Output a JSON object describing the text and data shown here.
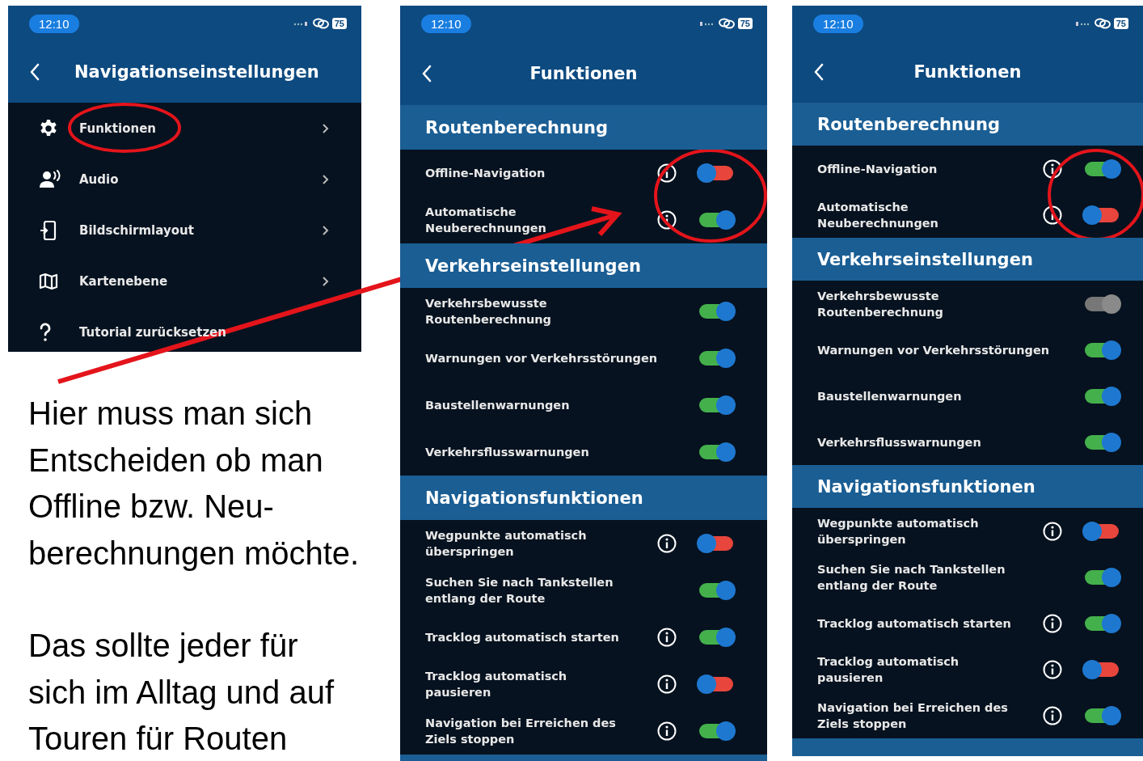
{
  "screens": [
    {
      "status": {
        "time": "12:10",
        "battery": "75"
      },
      "title": "Navigationseinstellungen",
      "menu": [
        {
          "label": "Funktionen",
          "chevron": true
        },
        {
          "label": "Audio",
          "chevron": true
        },
        {
          "label": "Bildschirmlayout",
          "chevron": true
        },
        {
          "label": "Kartenebene",
          "chevron": true
        },
        {
          "label": "Tutorial zurücksetzen",
          "chevron": false
        }
      ]
    },
    {
      "status": {
        "time": "12:10",
        "battery": "75"
      },
      "title": "Funktionen",
      "sections": [
        {
          "title": "Routenberechnung",
          "rows": [
            {
              "label": "Offline-Navigation",
              "info": true,
              "on": false,
              "disabled": false
            },
            {
              "label": "Automatische\nNeuberechnungen",
              "info": true,
              "on": true,
              "disabled": false
            }
          ]
        },
        {
          "title": "Verkehrseinstellungen",
          "rows": [
            {
              "label": "Verkehrsbewusste\nRoutenberechnung",
              "info": false,
              "on": true,
              "disabled": false
            },
            {
              "label": "Warnungen vor Verkehrsstörungen",
              "info": false,
              "on": true,
              "disabled": false
            },
            {
              "label": "Baustellenwarnungen",
              "info": false,
              "on": true,
              "disabled": false
            },
            {
              "label": "Verkehrsflusswarnungen",
              "info": false,
              "on": true,
              "disabled": false
            }
          ]
        },
        {
          "title": "Navigationsfunktionen",
          "rows": [
            {
              "label": "Wegpunkte automatisch\nüberspringen",
              "info": true,
              "on": false,
              "disabled": false
            },
            {
              "label": "Suchen Sie nach Tankstellen\nentlang der Route",
              "info": false,
              "on": true,
              "disabled": false
            },
            {
              "label": "Tracklog automatisch starten",
              "info": true,
              "on": true,
              "disabled": false
            },
            {
              "label": "Tracklog automatisch\npausieren",
              "info": true,
              "on": false,
              "disabled": false
            },
            {
              "label": "Navigation bei Erreichen des\nZiels stoppen",
              "info": true,
              "on": true,
              "disabled": false
            }
          ]
        }
      ]
    },
    {
      "status": {
        "time": "12:10",
        "battery": "75"
      },
      "title": "Funktionen",
      "sections": [
        {
          "title": "Routenberechnung",
          "rows": [
            {
              "label": "Offline-Navigation",
              "info": true,
              "on": true,
              "disabled": false
            },
            {
              "label": "Automatische\nNeuberechnungen",
              "info": true,
              "on": false,
              "disabled": false
            }
          ]
        },
        {
          "title": "Verkehrseinstellungen",
          "rows": [
            {
              "label": "Verkehrsbewusste\nRoutenberechnung",
              "info": false,
              "on": true,
              "disabled": true
            },
            {
              "label": "Warnungen vor Verkehrsstörungen",
              "info": false,
              "on": true,
              "disabled": false
            },
            {
              "label": "Baustellenwarnungen",
              "info": false,
              "on": true,
              "disabled": false
            },
            {
              "label": "Verkehrsflusswarnungen",
              "info": false,
              "on": true,
              "disabled": false
            }
          ]
        },
        {
          "title": "Navigationsfunktionen",
          "rows": [
            {
              "label": "Wegpunkte automatisch\nüberspringen",
              "info": true,
              "on": false,
              "disabled": false
            },
            {
              "label": "Suchen Sie nach Tankstellen\nentlang der Route",
              "info": false,
              "on": true,
              "disabled": false
            },
            {
              "label": "Tracklog automatisch starten",
              "info": true,
              "on": true,
              "disabled": false
            },
            {
              "label": "Tracklog automatisch\npausieren",
              "info": true,
              "on": false,
              "disabled": false
            },
            {
              "label": "Navigation bei Erreichen des\nZiels stoppen",
              "info": true,
              "on": true,
              "disabled": false
            }
          ]
        }
      ]
    }
  ],
  "notes": [
    "Hier muss man sich\nEntscheiden ob man\nOffline bzw. Neu-\nberechnungen möchte.",
    "Das sollte jeder für\nsich im Alltag und auf\nTouren für Routen"
  ]
}
